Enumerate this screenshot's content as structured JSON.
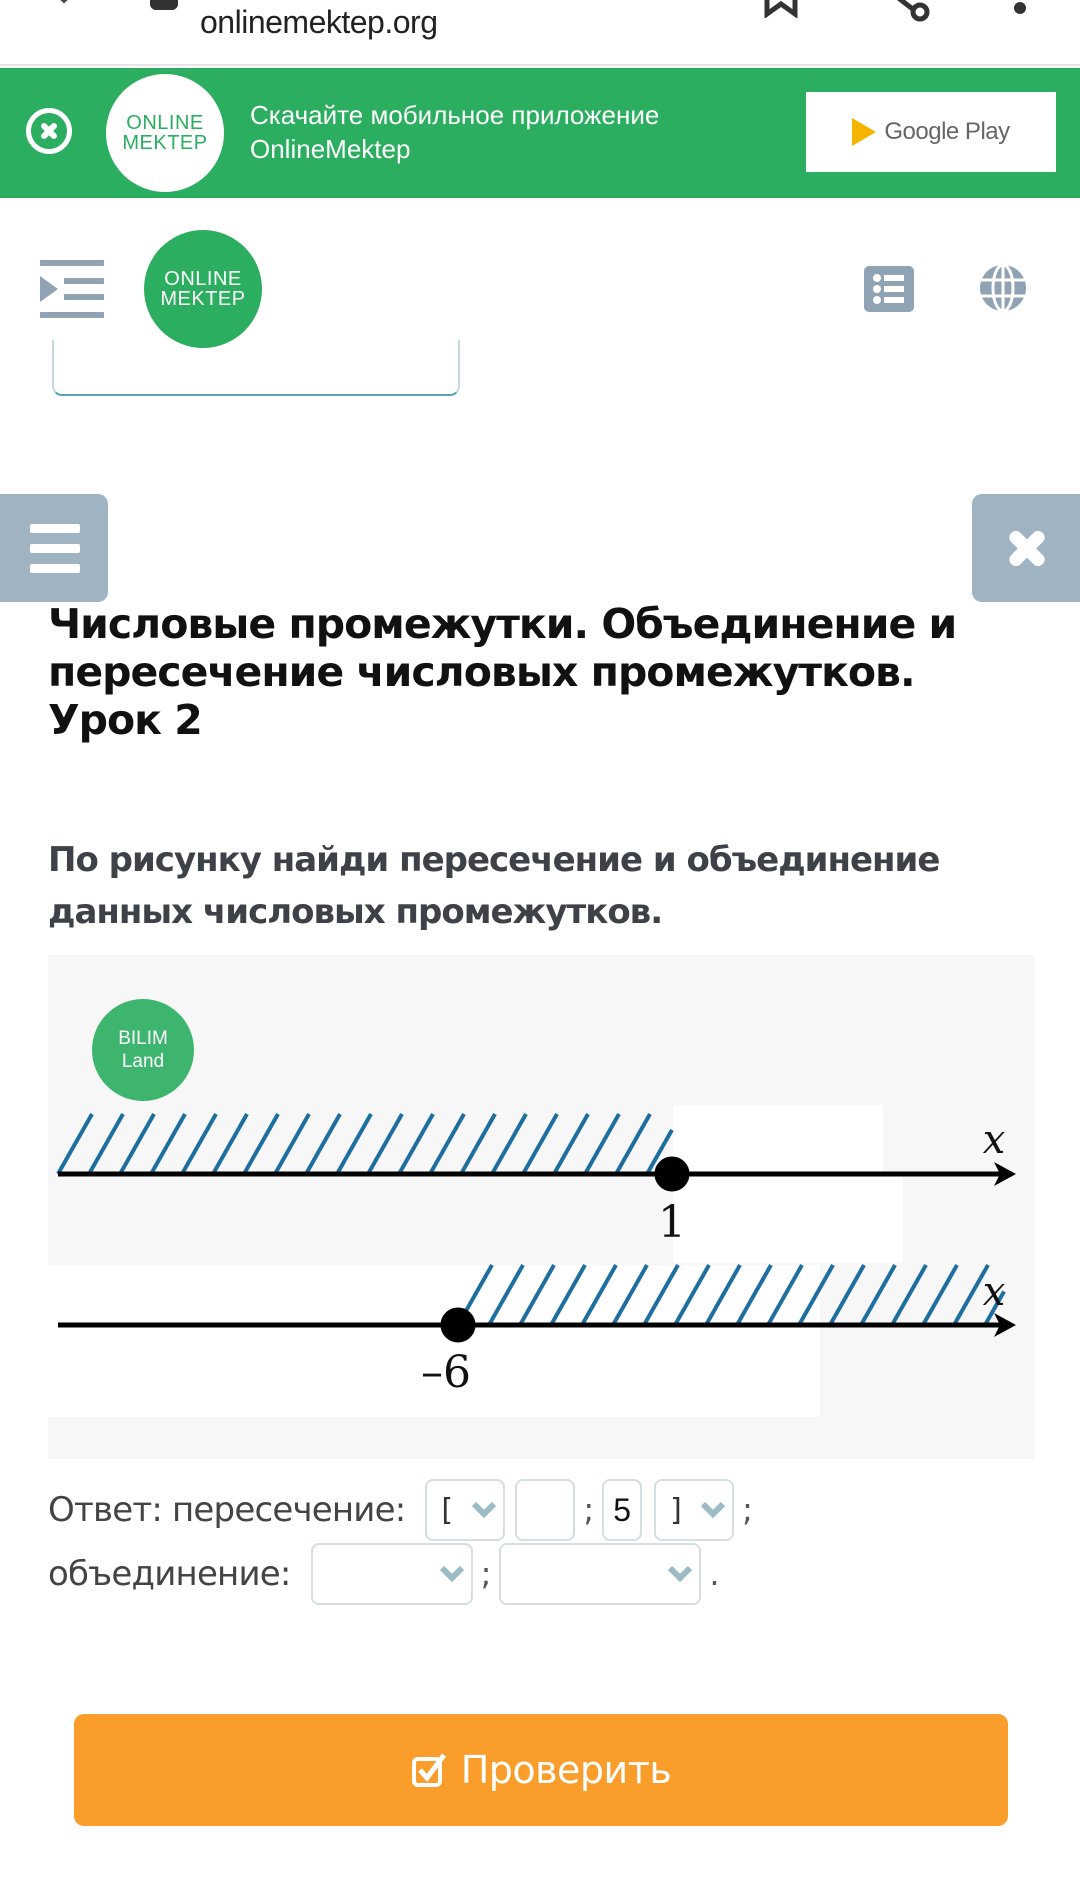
{
  "browser": {
    "url": "onlinemektep.org",
    "icons": [
      "close-icon",
      "lock-icon",
      "bookmark-icon",
      "share-icon",
      "more-icon"
    ]
  },
  "banner": {
    "message_line1": "Скачайте мобильное приложение",
    "message_line2": "OnlineMektep",
    "logo_line1": "ONLINE",
    "logo_line2": "MEKTEP",
    "store_label": "Google Play",
    "brand_color": "#2bae5f"
  },
  "header": {
    "logo_line1": "ONLINE",
    "logo_line2": "MEKTEP",
    "icons": [
      "indent-menu-icon",
      "list-icon",
      "globe-icon"
    ]
  },
  "lesson": {
    "title": "Числовые промежутки. Объединение и пересечение числовых промежутков. Урок 2"
  },
  "task": {
    "prompt": "По рисунку найди пересечение и объединение данных числовых промежутков.",
    "figure": {
      "watermark_line1": "BILIM",
      "watermark_line2": "Land",
      "axis_label": "x",
      "lines": [
        {
          "point": 1,
          "point_label": "1",
          "direction": "left",
          "closed": true
        },
        {
          "point": -6,
          "point_label": "–6",
          "direction": "right",
          "closed": true
        }
      ],
      "hatch_color": "#1e6f9f"
    }
  },
  "answer": {
    "intersection_label": "Ответ: пересечение:",
    "intersection": {
      "open_bracket": "[",
      "left_value": "",
      "separator": ";",
      "right_value": "5",
      "close_bracket": "]",
      "end": ";"
    },
    "union_label": "объединение:",
    "union": {
      "left_select": "",
      "separator": ";",
      "right_select": "",
      "end": "."
    }
  },
  "check_button": {
    "label": "Проверить",
    "color": "#fa9d2a"
  }
}
